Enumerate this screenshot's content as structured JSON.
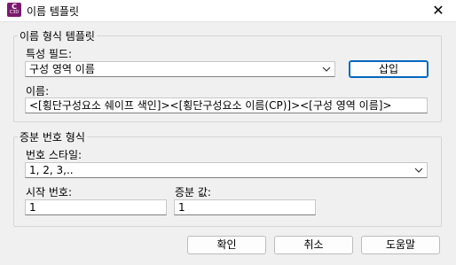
{
  "window": {
    "icon_text": "C",
    "icon_subtext": "C3D",
    "title": "이름 템플릿",
    "close_label": "✕"
  },
  "name_format": {
    "legend": "이름 형식 템플릿",
    "property_fields_label": "특성 필드:",
    "property_field_value": "구성 영역 이름",
    "insert_label": "삽입",
    "name_label": "이름:",
    "name_value": "<[횡단구성요소 쉐이프 색인]><[횡단구성요소 이름(CP)]><[구성 영역 이름]>"
  },
  "increment": {
    "legend": "증분 번호 형식",
    "style_label": "번호 스타일:",
    "style_value": "1, 2, 3,..",
    "start_label": "시작 번호:",
    "start_value": "1",
    "increment_label": "증분 값:",
    "increment_value": "1"
  },
  "buttons": {
    "ok": "확인",
    "cancel": "취소",
    "help": "도움말"
  }
}
